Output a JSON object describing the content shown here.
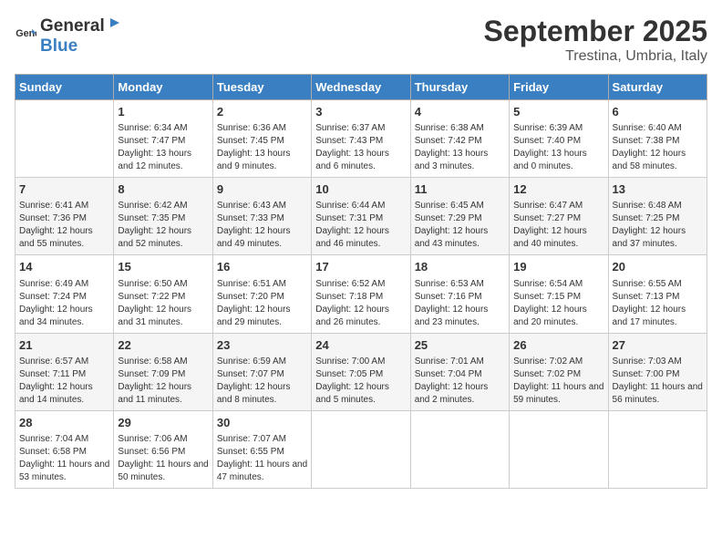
{
  "header": {
    "logo_general": "General",
    "logo_blue": "Blue",
    "month": "September 2025",
    "location": "Trestina, Umbria, Italy"
  },
  "calendar": {
    "days_of_week": [
      "Sunday",
      "Monday",
      "Tuesday",
      "Wednesday",
      "Thursday",
      "Friday",
      "Saturday"
    ],
    "weeks": [
      [
        {
          "day": "",
          "sunrise": "",
          "sunset": "",
          "daylight": ""
        },
        {
          "day": "1",
          "sunrise": "Sunrise: 6:34 AM",
          "sunset": "Sunset: 7:47 PM",
          "daylight": "Daylight: 13 hours and 12 minutes."
        },
        {
          "day": "2",
          "sunrise": "Sunrise: 6:36 AM",
          "sunset": "Sunset: 7:45 PM",
          "daylight": "Daylight: 13 hours and 9 minutes."
        },
        {
          "day": "3",
          "sunrise": "Sunrise: 6:37 AM",
          "sunset": "Sunset: 7:43 PM",
          "daylight": "Daylight: 13 hours and 6 minutes."
        },
        {
          "day": "4",
          "sunrise": "Sunrise: 6:38 AM",
          "sunset": "Sunset: 7:42 PM",
          "daylight": "Daylight: 13 hours and 3 minutes."
        },
        {
          "day": "5",
          "sunrise": "Sunrise: 6:39 AM",
          "sunset": "Sunset: 7:40 PM",
          "daylight": "Daylight: 13 hours and 0 minutes."
        },
        {
          "day": "6",
          "sunrise": "Sunrise: 6:40 AM",
          "sunset": "Sunset: 7:38 PM",
          "daylight": "Daylight: 12 hours and 58 minutes."
        }
      ],
      [
        {
          "day": "7",
          "sunrise": "Sunrise: 6:41 AM",
          "sunset": "Sunset: 7:36 PM",
          "daylight": "Daylight: 12 hours and 55 minutes."
        },
        {
          "day": "8",
          "sunrise": "Sunrise: 6:42 AM",
          "sunset": "Sunset: 7:35 PM",
          "daylight": "Daylight: 12 hours and 52 minutes."
        },
        {
          "day": "9",
          "sunrise": "Sunrise: 6:43 AM",
          "sunset": "Sunset: 7:33 PM",
          "daylight": "Daylight: 12 hours and 49 minutes."
        },
        {
          "day": "10",
          "sunrise": "Sunrise: 6:44 AM",
          "sunset": "Sunset: 7:31 PM",
          "daylight": "Daylight: 12 hours and 46 minutes."
        },
        {
          "day": "11",
          "sunrise": "Sunrise: 6:45 AM",
          "sunset": "Sunset: 7:29 PM",
          "daylight": "Daylight: 12 hours and 43 minutes."
        },
        {
          "day": "12",
          "sunrise": "Sunrise: 6:47 AM",
          "sunset": "Sunset: 7:27 PM",
          "daylight": "Daylight: 12 hours and 40 minutes."
        },
        {
          "day": "13",
          "sunrise": "Sunrise: 6:48 AM",
          "sunset": "Sunset: 7:25 PM",
          "daylight": "Daylight: 12 hours and 37 minutes."
        }
      ],
      [
        {
          "day": "14",
          "sunrise": "Sunrise: 6:49 AM",
          "sunset": "Sunset: 7:24 PM",
          "daylight": "Daylight: 12 hours and 34 minutes."
        },
        {
          "day": "15",
          "sunrise": "Sunrise: 6:50 AM",
          "sunset": "Sunset: 7:22 PM",
          "daylight": "Daylight: 12 hours and 31 minutes."
        },
        {
          "day": "16",
          "sunrise": "Sunrise: 6:51 AM",
          "sunset": "Sunset: 7:20 PM",
          "daylight": "Daylight: 12 hours and 29 minutes."
        },
        {
          "day": "17",
          "sunrise": "Sunrise: 6:52 AM",
          "sunset": "Sunset: 7:18 PM",
          "daylight": "Daylight: 12 hours and 26 minutes."
        },
        {
          "day": "18",
          "sunrise": "Sunrise: 6:53 AM",
          "sunset": "Sunset: 7:16 PM",
          "daylight": "Daylight: 12 hours and 23 minutes."
        },
        {
          "day": "19",
          "sunrise": "Sunrise: 6:54 AM",
          "sunset": "Sunset: 7:15 PM",
          "daylight": "Daylight: 12 hours and 20 minutes."
        },
        {
          "day": "20",
          "sunrise": "Sunrise: 6:55 AM",
          "sunset": "Sunset: 7:13 PM",
          "daylight": "Daylight: 12 hours and 17 minutes."
        }
      ],
      [
        {
          "day": "21",
          "sunrise": "Sunrise: 6:57 AM",
          "sunset": "Sunset: 7:11 PM",
          "daylight": "Daylight: 12 hours and 14 minutes."
        },
        {
          "day": "22",
          "sunrise": "Sunrise: 6:58 AM",
          "sunset": "Sunset: 7:09 PM",
          "daylight": "Daylight: 12 hours and 11 minutes."
        },
        {
          "day": "23",
          "sunrise": "Sunrise: 6:59 AM",
          "sunset": "Sunset: 7:07 PM",
          "daylight": "Daylight: 12 hours and 8 minutes."
        },
        {
          "day": "24",
          "sunrise": "Sunrise: 7:00 AM",
          "sunset": "Sunset: 7:05 PM",
          "daylight": "Daylight: 12 hours and 5 minutes."
        },
        {
          "day": "25",
          "sunrise": "Sunrise: 7:01 AM",
          "sunset": "Sunset: 7:04 PM",
          "daylight": "Daylight: 12 hours and 2 minutes."
        },
        {
          "day": "26",
          "sunrise": "Sunrise: 7:02 AM",
          "sunset": "Sunset: 7:02 PM",
          "daylight": "Daylight: 11 hours and 59 minutes."
        },
        {
          "day": "27",
          "sunrise": "Sunrise: 7:03 AM",
          "sunset": "Sunset: 7:00 PM",
          "daylight": "Daylight: 11 hours and 56 minutes."
        }
      ],
      [
        {
          "day": "28",
          "sunrise": "Sunrise: 7:04 AM",
          "sunset": "Sunset: 6:58 PM",
          "daylight": "Daylight: 11 hours and 53 minutes."
        },
        {
          "day": "29",
          "sunrise": "Sunrise: 7:06 AM",
          "sunset": "Sunset: 6:56 PM",
          "daylight": "Daylight: 11 hours and 50 minutes."
        },
        {
          "day": "30",
          "sunrise": "Sunrise: 7:07 AM",
          "sunset": "Sunset: 6:55 PM",
          "daylight": "Daylight: 11 hours and 47 minutes."
        },
        {
          "day": "",
          "sunrise": "",
          "sunset": "",
          "daylight": ""
        },
        {
          "day": "",
          "sunrise": "",
          "sunset": "",
          "daylight": ""
        },
        {
          "day": "",
          "sunrise": "",
          "sunset": "",
          "daylight": ""
        },
        {
          "day": "",
          "sunrise": "",
          "sunset": "",
          "daylight": ""
        }
      ]
    ]
  }
}
